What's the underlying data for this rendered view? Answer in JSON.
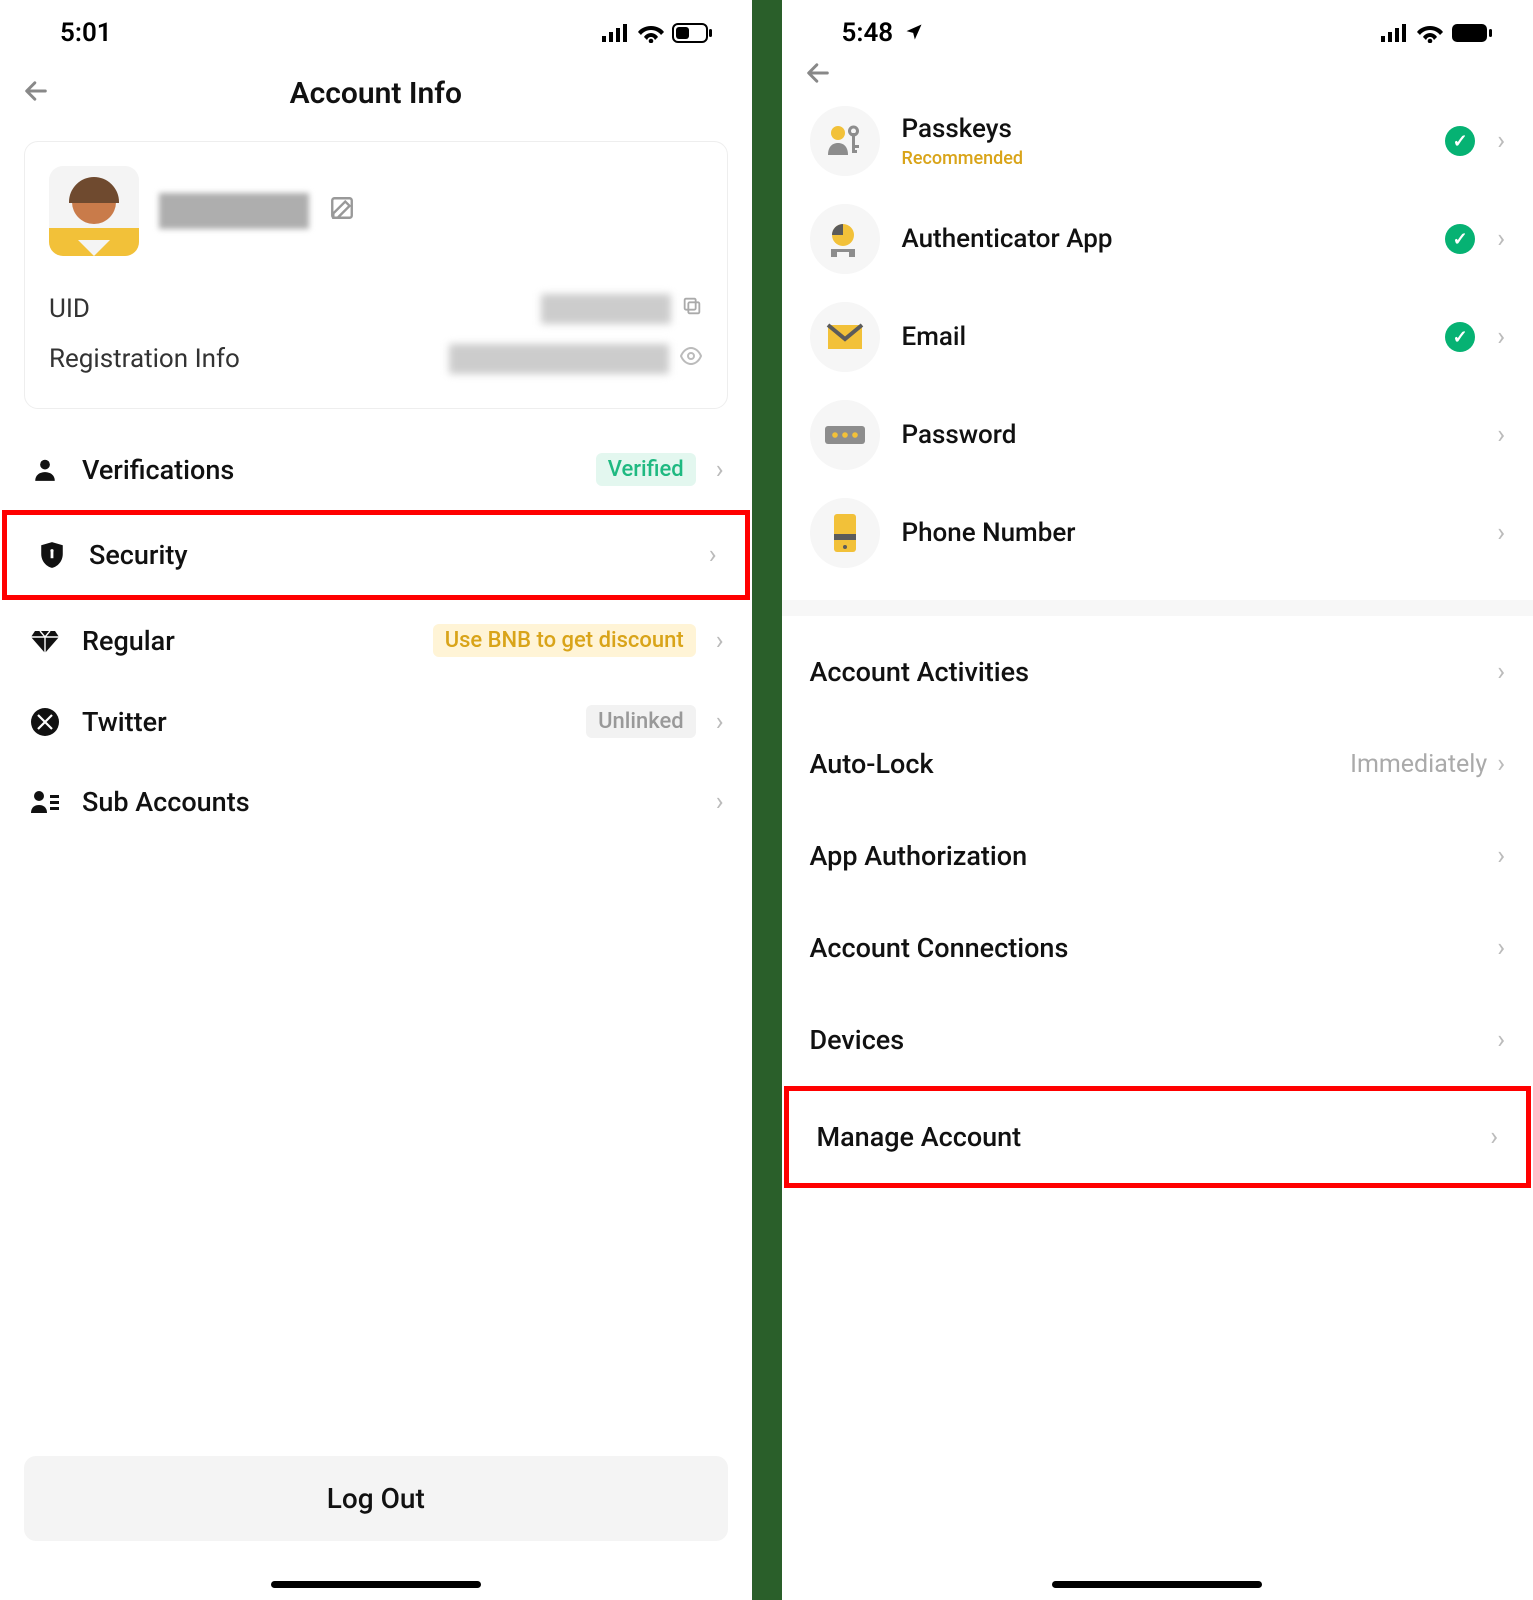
{
  "left": {
    "status_time": "5:01",
    "title": "Account Info",
    "profile": {
      "uid_label": "UID",
      "reg_label": "Registration Info"
    },
    "rows": [
      {
        "label": "Verifications",
        "badge": "Verified",
        "badge_class": "badge-verified",
        "highlight": false
      },
      {
        "label": "Security",
        "highlight": true
      },
      {
        "label": "Regular",
        "badge": "Use BNB to get discount",
        "badge_class": "badge-bnb",
        "highlight": false
      },
      {
        "label": "Twitter",
        "badge": "Unlinked",
        "badge_class": "badge-unlinked",
        "highlight": false
      },
      {
        "label": "Sub Accounts",
        "highlight": false
      }
    ],
    "logout": "Log Out"
  },
  "right": {
    "status_time": "5:48",
    "sec_items": [
      {
        "title": "Passkeys",
        "sub": "Recommended",
        "checked": true
      },
      {
        "title": "Authenticator App",
        "checked": true
      },
      {
        "title": "Email",
        "checked": true
      },
      {
        "title": "Password",
        "checked": false
      },
      {
        "title": "Phone Number",
        "checked": false
      }
    ],
    "plain_items": [
      {
        "label": "Account Activities"
      },
      {
        "label": "Auto-Lock",
        "value": "Immediately"
      },
      {
        "label": "App Authorization"
      },
      {
        "label": "Account Connections"
      },
      {
        "label": "Devices"
      },
      {
        "label": "Manage Account",
        "highlight": true
      }
    ]
  }
}
